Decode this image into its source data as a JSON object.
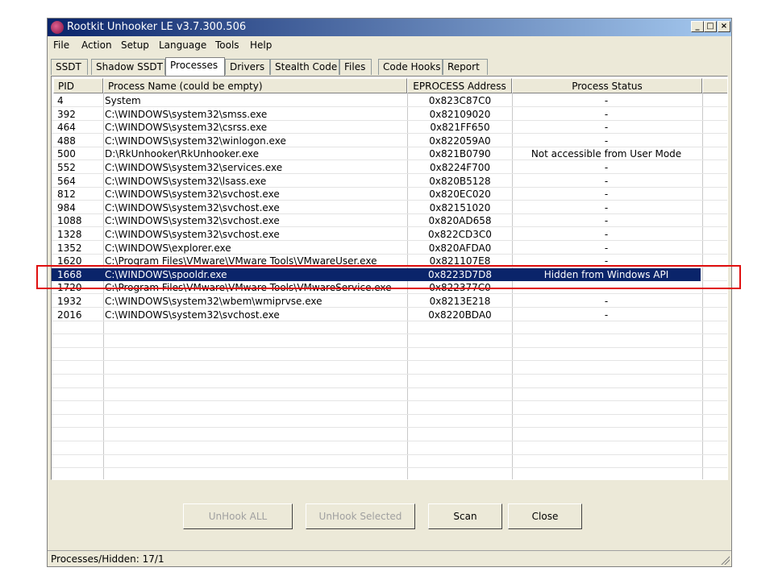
{
  "window": {
    "title": "Rootkit Unhooker LE v3.7.300.506",
    "minimize": "_",
    "maximize": "□",
    "close": "×"
  },
  "menu": [
    "File",
    "Action",
    "Setup",
    "Language",
    "Tools",
    "Help"
  ],
  "tabs": [
    "SSDT",
    "Shadow SSDT",
    "Processes",
    "Drivers",
    "Stealth Code",
    "Files",
    "Code Hooks",
    "Report"
  ],
  "active_tab": "Processes",
  "table": {
    "headers": [
      "PID",
      "Process Name (could be empty)",
      "EPROCESS Address",
      "Process Status"
    ],
    "rows": [
      {
        "pid": "4",
        "name": "System",
        "addr": "0x823C87C0",
        "status": "-"
      },
      {
        "pid": "392",
        "name": "C:\\WINDOWS\\system32\\smss.exe",
        "addr": "0x82109020",
        "status": "-"
      },
      {
        "pid": "464",
        "name": "C:\\WINDOWS\\system32\\csrss.exe",
        "addr": "0x821FF650",
        "status": "-"
      },
      {
        "pid": "488",
        "name": "C:\\WINDOWS\\system32\\winlogon.exe",
        "addr": "0x822059A0",
        "status": "-"
      },
      {
        "pid": "500",
        "name": "D:\\RkUnhooker\\RkUnhooker.exe",
        "addr": "0x821B0790",
        "status": "Not accessible from User Mode"
      },
      {
        "pid": "552",
        "name": "C:\\WINDOWS\\system32\\services.exe",
        "addr": "0x8224F700",
        "status": "-"
      },
      {
        "pid": "564",
        "name": "C:\\WINDOWS\\system32\\lsass.exe",
        "addr": "0x820B5128",
        "status": "-"
      },
      {
        "pid": "812",
        "name": "C:\\WINDOWS\\system32\\svchost.exe",
        "addr": "0x820EC020",
        "status": "-"
      },
      {
        "pid": "984",
        "name": "C:\\WINDOWS\\system32\\svchost.exe",
        "addr": "0x82151020",
        "status": "-"
      },
      {
        "pid": "1088",
        "name": "C:\\WINDOWS\\system32\\svchost.exe",
        "addr": "0x820AD658",
        "status": "-"
      },
      {
        "pid": "1328",
        "name": "C:\\WINDOWS\\system32\\svchost.exe",
        "addr": "0x822CD3C0",
        "status": "-"
      },
      {
        "pid": "1352",
        "name": "C:\\WINDOWS\\explorer.exe",
        "addr": "0x820AFDA0",
        "status": "-"
      },
      {
        "pid": "1620",
        "name": "C:\\Program Files\\VMware\\VMware Tools\\VMwareUser.exe",
        "addr": "0x821107E8",
        "status": "-"
      },
      {
        "pid": "1668",
        "name": "C:\\WINDOWS\\spooldr.exe",
        "addr": "0x8223D7D8",
        "status": "Hidden from Windows API",
        "selected": true
      },
      {
        "pid": "1720",
        "name": "C:\\Program Files\\VMware\\VMware Tools\\VMwareService.exe",
        "addr": "0x822377C0",
        "status": "-"
      },
      {
        "pid": "1932",
        "name": "C:\\WINDOWS\\system32\\wbem\\wmiprvse.exe",
        "addr": "0x8213E218",
        "status": "-"
      },
      {
        "pid": "2016",
        "name": "C:\\WINDOWS\\system32\\svchost.exe",
        "addr": "0x8220BDA0",
        "status": "-"
      }
    ]
  },
  "buttons": {
    "unhook_all": "UnHook ALL",
    "unhook_selected": "UnHook Selected",
    "scan": "Scan",
    "close": "Close"
  },
  "status_bar": "Processes/Hidden: 17/1",
  "colors": {
    "title_gradient_start": "#0a246a",
    "title_gradient_end": "#a6caf0",
    "selection": "#0a246a",
    "highlight_box": "#e01010"
  }
}
